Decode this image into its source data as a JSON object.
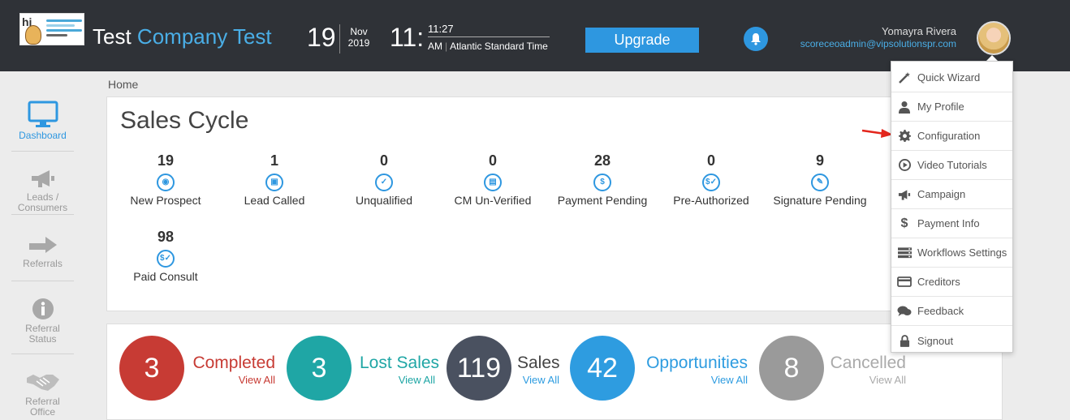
{
  "header": {
    "company_prefix": "Test",
    "company_accent": "Company Test",
    "day": "19",
    "month": "Nov",
    "year": "2019",
    "hour": "11:",
    "minute_line": "11:27",
    "ampm": "AM",
    "timezone": "Atlantic Standard Time",
    "upgrade_label": "Upgrade",
    "user_name": "Yomayra Rivera",
    "user_email": "scoreceoadmin@vipsolutionspr.com"
  },
  "breadcrumb": "Home",
  "sidebar": {
    "items": [
      {
        "label": "Dashboard",
        "icon": "monitor-icon"
      },
      {
        "label": "Leads / Consumers",
        "icon": "megaphone-icon"
      },
      {
        "label": "Referrals",
        "icon": "share-arrow-icon"
      },
      {
        "label": "Referral Status",
        "icon": "info-icon"
      },
      {
        "label": "Referral Office",
        "icon": "handshake-icon"
      }
    ]
  },
  "sales_cycle": {
    "title": "Sales Cycle",
    "stages": [
      {
        "count": "19",
        "label": "New Prospect"
      },
      {
        "count": "1",
        "label": "Lead Called"
      },
      {
        "count": "0",
        "label": "Unqualified"
      },
      {
        "count": "0",
        "label": "CM Un-Verified"
      },
      {
        "count": "28",
        "label": "Payment Pending"
      },
      {
        "count": "0",
        "label": "Pre-Authorized"
      },
      {
        "count": "9",
        "label": "Signature Pending"
      },
      {
        "count": "98",
        "label": "Paid Consult"
      }
    ]
  },
  "stats": [
    {
      "value": "3",
      "label": "Completed",
      "link": "View All",
      "color": "#c73b34"
    },
    {
      "value": "3",
      "label": "Lost Sales",
      "link": "View All",
      "color": "#1fa6a5"
    },
    {
      "value": "119",
      "label": "Sales",
      "link": "View All",
      "color": "#4a5160"
    },
    {
      "value": "42",
      "label": "Opportunities",
      "link": "View All",
      "color": "#2e9ce0"
    },
    {
      "value": "8",
      "label": "Cancelled",
      "link": "View All",
      "color": "#9a9a9a"
    }
  ],
  "menu": {
    "items": [
      {
        "label": "Quick Wizard",
        "icon": "magic-wand-icon"
      },
      {
        "label": "My Profile",
        "icon": "user-icon"
      },
      {
        "label": "Configuration",
        "icon": "gear-icon"
      },
      {
        "label": "Video Tutorials",
        "icon": "play-circle-icon"
      },
      {
        "label": "Campaign",
        "icon": "megaphone-icon"
      },
      {
        "label": "Payment Info",
        "icon": "dollar-icon"
      },
      {
        "label": "Workflows Settings",
        "icon": "server-icon"
      },
      {
        "label": "Creditors",
        "icon": "credit-card-icon"
      },
      {
        "label": "Feedback",
        "icon": "comments-icon"
      },
      {
        "label": "Signout",
        "icon": "lock-icon"
      }
    ]
  },
  "colors": {
    "header_bg": "#2f3237",
    "accent": "#2e97e0",
    "annotation_arrow": "#e3261c"
  }
}
